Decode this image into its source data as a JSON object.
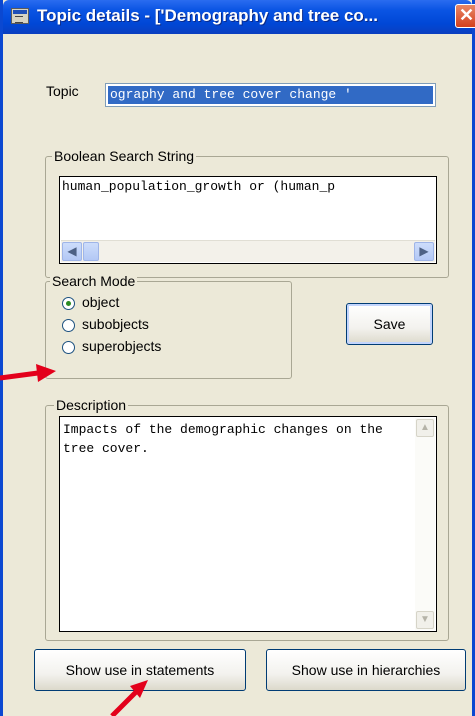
{
  "window": {
    "title": "Topic details - ['Demography and tree co...",
    "close_label": "✕"
  },
  "topic": {
    "label": "Topic",
    "value": "ography and tree cover change '"
  },
  "boolean_search": {
    "legend": "Boolean Search String",
    "value": "human_population_growth or (human_p",
    "scroll_left": "◀",
    "scroll_right": "▶"
  },
  "search_mode": {
    "legend": "Search Mode",
    "options": [
      {
        "label": "object",
        "checked": true
      },
      {
        "label": "subobjects",
        "checked": false
      },
      {
        "label": "superobjects",
        "checked": false
      }
    ]
  },
  "save_label": "Save",
  "description": {
    "legend": "Description",
    "value": "Impacts of the demographic changes on the tree cover.",
    "scroll_up": "▲",
    "scroll_down": "▼"
  },
  "buttons": {
    "show_statements": "Show use in statements",
    "show_hierarchies": "Show use in hierarchies"
  },
  "annotation_color": "#e3001b"
}
